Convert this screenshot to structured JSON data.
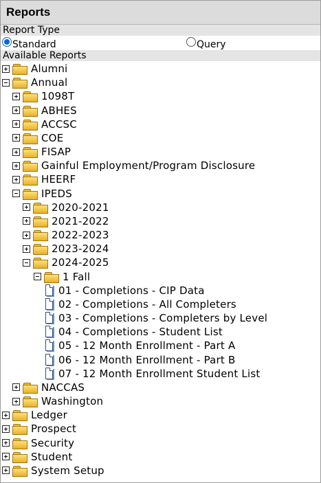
{
  "header": {
    "title": "Reports"
  },
  "report_type": {
    "label": "Report Type",
    "options": [
      {
        "label": "Standard",
        "selected": true
      },
      {
        "label": "Query",
        "selected": false
      }
    ]
  },
  "available": {
    "label": "Available Reports"
  },
  "tree": [
    {
      "label": "Alumni",
      "depth": 0,
      "kind": "folder",
      "toggle": "plus"
    },
    {
      "label": "Annual",
      "depth": 0,
      "kind": "folder",
      "toggle": "minus"
    },
    {
      "label": "1098T",
      "depth": 1,
      "kind": "folder",
      "toggle": "plus"
    },
    {
      "label": "ABHES",
      "depth": 1,
      "kind": "folder",
      "toggle": "plus"
    },
    {
      "label": "ACCSC",
      "depth": 1,
      "kind": "folder",
      "toggle": "plus"
    },
    {
      "label": "COE",
      "depth": 1,
      "kind": "folder",
      "toggle": "plus"
    },
    {
      "label": "FISAP",
      "depth": 1,
      "kind": "folder",
      "toggle": "plus"
    },
    {
      "label": "Gainful Employment/Program Disclosure",
      "depth": 1,
      "kind": "folder",
      "toggle": "plus"
    },
    {
      "label": "HEERF",
      "depth": 1,
      "kind": "folder",
      "toggle": "plus"
    },
    {
      "label": "IPEDS",
      "depth": 1,
      "kind": "folder",
      "toggle": "minus"
    },
    {
      "label": "2020-2021",
      "depth": 2,
      "kind": "folder",
      "toggle": "plus"
    },
    {
      "label": "2021-2022",
      "depth": 2,
      "kind": "folder",
      "toggle": "plus"
    },
    {
      "label": "2022-2023",
      "depth": 2,
      "kind": "folder",
      "toggle": "plus"
    },
    {
      "label": "2023-2024",
      "depth": 2,
      "kind": "folder",
      "toggle": "plus"
    },
    {
      "label": "2024-2025",
      "depth": 2,
      "kind": "folder",
      "toggle": "minus"
    },
    {
      "label": "1 Fall",
      "depth": 3,
      "kind": "folder",
      "toggle": "minus"
    },
    {
      "label": "01 - Completions - CIP Data",
      "depth": 4,
      "kind": "report"
    },
    {
      "label": "02 - Completions - All Completers",
      "depth": 4,
      "kind": "report"
    },
    {
      "label": "03 - Completions - Completers by Level",
      "depth": 4,
      "kind": "report"
    },
    {
      "label": "04 - Completions - Student List",
      "depth": 4,
      "kind": "report"
    },
    {
      "label": "05 - 12 Month Enrollment - Part A",
      "depth": 4,
      "kind": "report"
    },
    {
      "label": "06 - 12 Month Enrollment - Part B",
      "depth": 4,
      "kind": "report"
    },
    {
      "label": "07 - 12 Month Enrollment Student List",
      "depth": 4,
      "kind": "report"
    },
    {
      "label": "NACCAS",
      "depth": 1,
      "kind": "folder",
      "toggle": "plus"
    },
    {
      "label": "Washington",
      "depth": 1,
      "kind": "folder",
      "toggle": "plus"
    },
    {
      "label": "Ledger",
      "depth": 0,
      "kind": "folder",
      "toggle": "plus"
    },
    {
      "label": "Prospect",
      "depth": 0,
      "kind": "folder",
      "toggle": "plus"
    },
    {
      "label": "Security",
      "depth": 0,
      "kind": "folder",
      "toggle": "plus"
    },
    {
      "label": "Student",
      "depth": 0,
      "kind": "folder",
      "toggle": "plus"
    },
    {
      "label": "System Setup",
      "depth": 0,
      "kind": "folder",
      "toggle": "plus"
    }
  ]
}
